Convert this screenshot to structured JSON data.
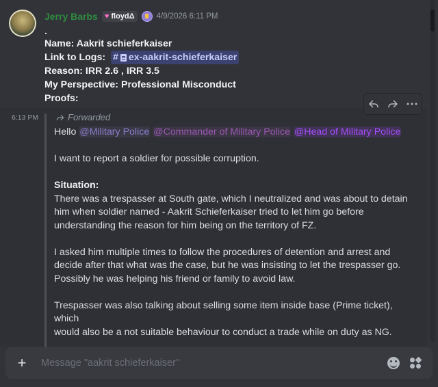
{
  "message1": {
    "username": "Jerry Barbs",
    "clan_tag": "floydΔ",
    "timestamp": "4/9/2026 6:11 PM",
    "dot": ".",
    "name_line": "Name: Aakrit schieferkaiser",
    "link_label": "Link to Logs:",
    "channel_hash": "#",
    "channel_name": "ex-aakrit-schieferkaiser",
    "reason_line": "Reason: IRR 2.6 , IRR 3.5",
    "perspective_line": "My Perspective: Professional Misconduct",
    "proofs_line": "Proofs:"
  },
  "toolbar": {
    "reply_icon": "reply-icon",
    "forward_icon": "forward-icon",
    "more_icon": "more-icon",
    "more_label": "⋯"
  },
  "message2": {
    "timestamp": "6:13 PM",
    "forwarded_label": "Forwarded",
    "hello": "Hello",
    "mention_1": "@Military Police",
    "mention_2": "@Commander of Military Police",
    "mention_3": "@Head of Military Police",
    "intro": "I want to report a soldier for possible corruption.",
    "situation_heading": "Situation:",
    "para1_line1": "There was a trespasser at South gate, which I neutralized and was about to detain",
    "para1_line2": "him when soldier named  - Aakrit Schieferkaiser tried to let him go before",
    "para1_line3": "understanding the reason for him being on the territory of FZ.",
    "para2_line1": "I asked him multiple times to follow the procedures of detention and arrest  and",
    "para2_line2": "decide after that what was the case, but he was insisting to let the trespasser go.",
    "para2_line3": "Possibly he was helping his friend or family to avoid law.",
    "para3_line1": "Trespasser was also talking about selling some item inside base (Prime ticket), which",
    "para3_line2": "would also be a not suitable behaviour to conduct a trade while on duty as NG.",
    "para4_faded": "..."
  },
  "composer": {
    "placeholder": "Message \"aakrit schieferkaiser\"",
    "add_label": "+"
  },
  "colors": {
    "background": "#313338",
    "role_mention": "#9b59b6",
    "channel_mention_bg": "#3c4270",
    "username": "#2e8b3f"
  }
}
